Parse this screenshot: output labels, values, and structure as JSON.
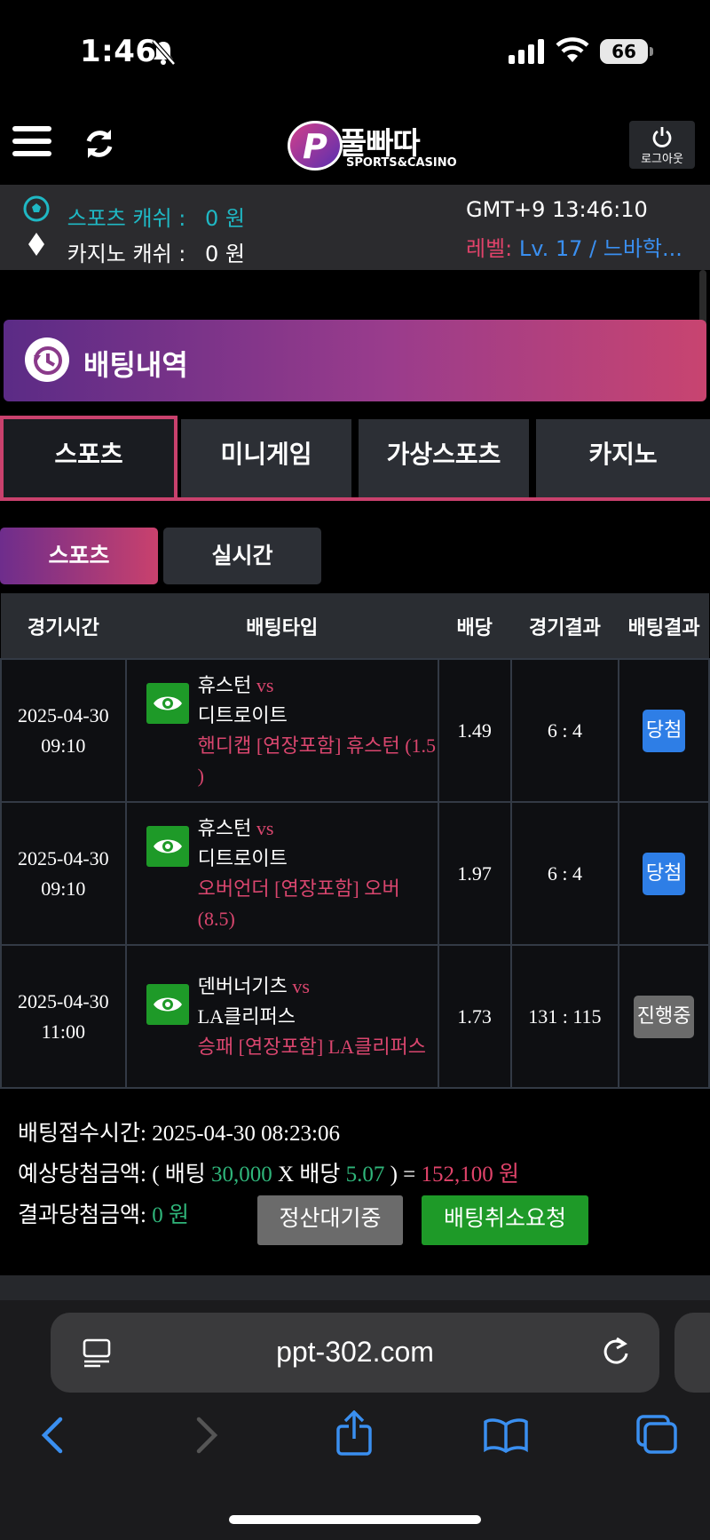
{
  "status_bar": {
    "time": "1:46",
    "battery": "66"
  },
  "header": {
    "logo_name": "풀빠따",
    "logo_sub": "SPORTS&CASINO",
    "logo_letter": "P",
    "logout_label": "로그아웃"
  },
  "info": {
    "sports_cash_label": "스포츠 캐쉬 :",
    "sports_cash_value": "0 원",
    "casino_cash_label": "카지노 캐쉬 :",
    "casino_cash_value": "0 원",
    "clock": "GMT+9 13:46:10",
    "level_label": "레벨:",
    "level_value": "Lv. 17 / 느바학..."
  },
  "page": {
    "title": "배팅내역"
  },
  "tabs": [
    {
      "label": "스포츠",
      "active": true
    },
    {
      "label": "미니게임",
      "active": false
    },
    {
      "label": "가상스포츠",
      "active": false
    },
    {
      "label": "카지노",
      "active": false
    }
  ],
  "subtabs": [
    {
      "label": "스포츠",
      "active": true
    },
    {
      "label": "실시간",
      "active": false
    }
  ],
  "table": {
    "headers": [
      "경기시간",
      "배팅타입",
      "배당",
      "경기결과",
      "배팅결과"
    ],
    "vs_label": "vs",
    "rows": [
      {
        "date": "2025-04-30",
        "time": "09:10",
        "home": "휴스턴",
        "away": "디트로이트",
        "market": "핸디캡 [연장포함] 휴스턴 (1.5 )",
        "odds": "1.49",
        "score": "6 : 4",
        "result": "당첨"
      },
      {
        "date": "2025-04-30",
        "time": "09:10",
        "home": "휴스턴",
        "away": "디트로이트",
        "market": "오버언더 [연장포함] 오버 (8.5)",
        "odds": "1.97",
        "score": "6 : 4",
        "result": "당첨"
      },
      {
        "date": "2025-04-30",
        "time": "11:00",
        "home": "덴버너기츠",
        "away": "LA클리퍼스",
        "market": "승패 [연장포함] LA클리퍼스",
        "odds": "1.73",
        "score": "131 : 115",
        "result": "진행중"
      }
    ]
  },
  "summary": {
    "receipt_label": "배팅접수시간:",
    "receipt_time": "2025-04-30 08:23:06",
    "expected_label": "예상당첨금액:",
    "open_paren": "( 배팅",
    "stake": "30,000",
    "x_odds": "X 배당",
    "total_odds": "5.07",
    "close_eq": ") =",
    "expected_win": "152,100 원",
    "result_label": "결과당첨금액:",
    "result_win": "0 원",
    "wait_button": "정산대기중",
    "cancel_button": "배팅취소요청"
  },
  "browser": {
    "url": "ppt-302.com"
  },
  "colors": {
    "accent_pink": "#c9416d",
    "accent_purple": "#5b2b86",
    "win_blue": "#2e7ee6",
    "green": "#1e9a28",
    "cyan": "#1fb8c4"
  }
}
